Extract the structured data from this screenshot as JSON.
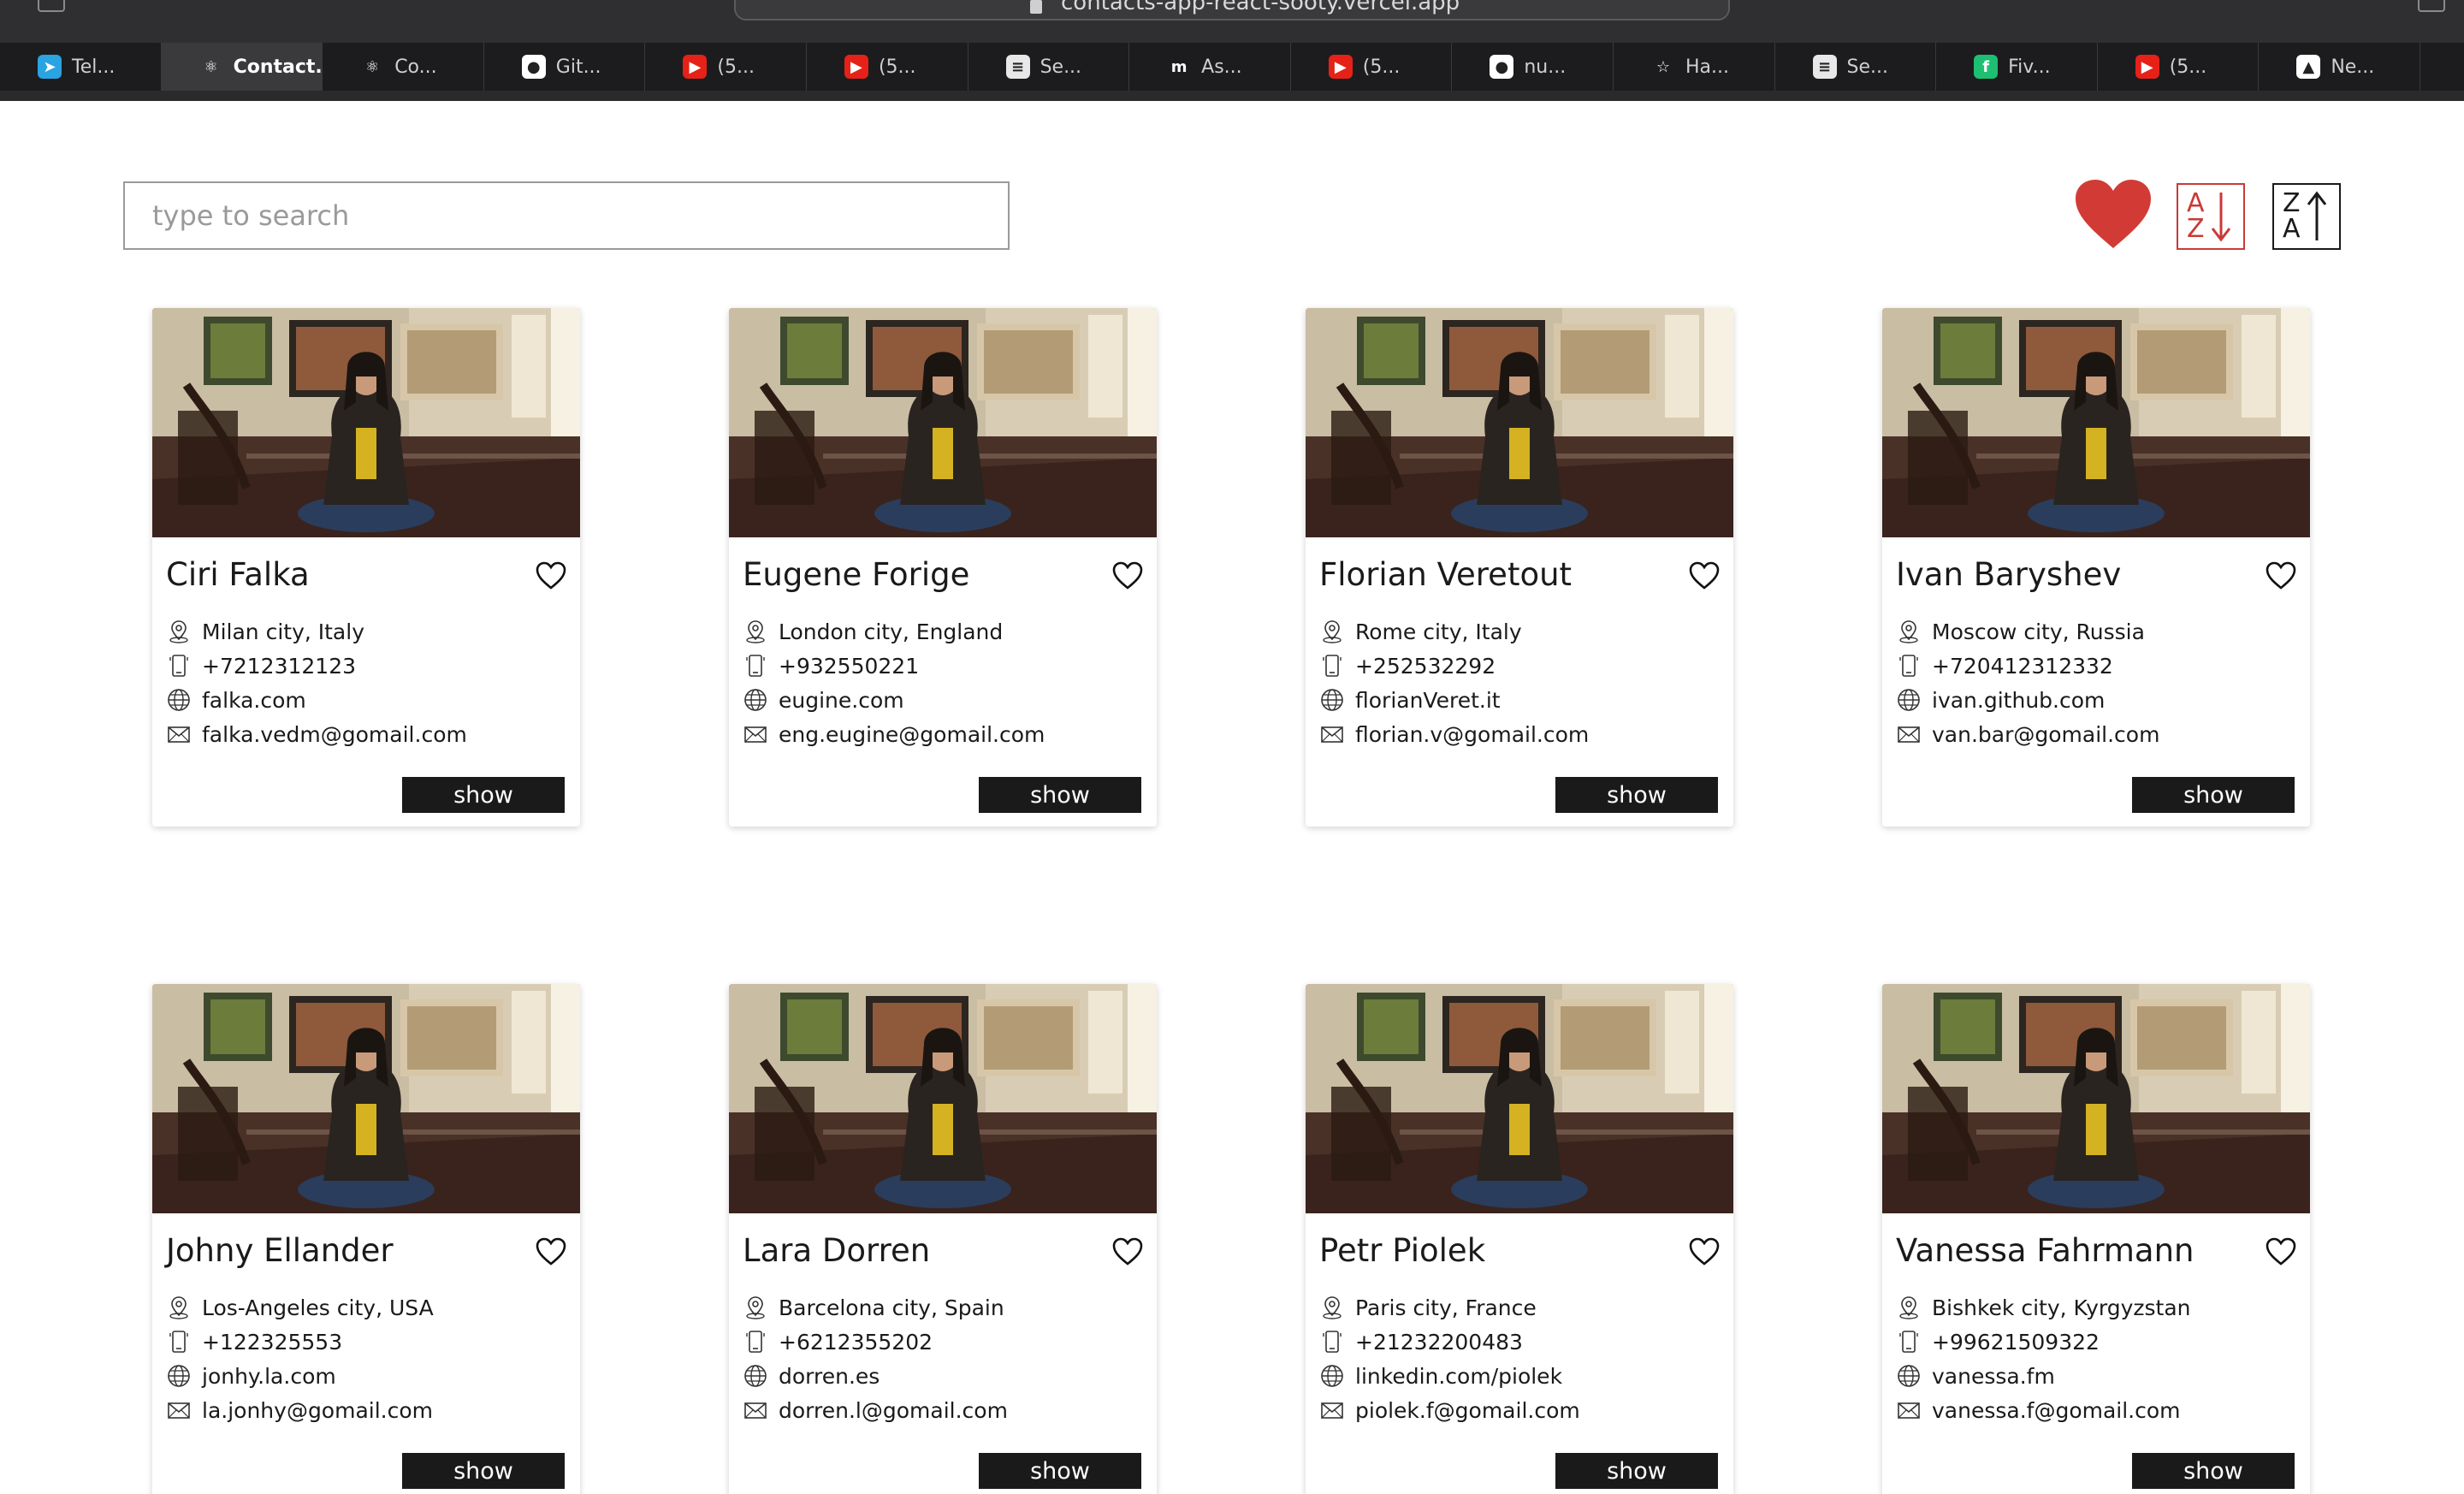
{
  "browser": {
    "url": "contacts-app-react-sooty.vercel.app",
    "tabs": [
      {
        "label": "Tel...",
        "icon": "telegram-icon",
        "color": "#2aa3e1",
        "glyph": "➤"
      },
      {
        "label": "Contact...",
        "icon": "react-icon",
        "color": "#3a3a3c",
        "glyph": "⚛",
        "active": true
      },
      {
        "label": "Co...",
        "icon": "react-icon",
        "color": "#1c1c1e",
        "glyph": "⚛"
      },
      {
        "label": "Git...",
        "icon": "github-icon",
        "color": "#ffffff",
        "glyph": "●"
      },
      {
        "label": "(5...",
        "icon": "youtube-icon",
        "color": "#e62117",
        "glyph": "▶"
      },
      {
        "label": "(5...",
        "icon": "youtube-icon",
        "color": "#e62117",
        "glyph": "▶"
      },
      {
        "label": "Se...",
        "icon": "document-icon",
        "color": "#e8e8e8",
        "glyph": "≡"
      },
      {
        "label": "As...",
        "icon": "m-icon",
        "color": "#1c1c1e",
        "glyph": "m"
      },
      {
        "label": "(5...",
        "icon": "youtube-icon",
        "color": "#e62117",
        "glyph": "▶"
      },
      {
        "label": "nu...",
        "icon": "github-icon",
        "color": "#ffffff",
        "glyph": "●"
      },
      {
        "label": "Ha...",
        "icon": "star-icon",
        "color": "#1c1c1e",
        "glyph": "☆"
      },
      {
        "label": "Se...",
        "icon": "document-icon",
        "color": "#e8e8e8",
        "glyph": "≡"
      },
      {
        "label": "Fiv...",
        "icon": "fiverr-icon",
        "color": "#1dbf73",
        "glyph": "f"
      },
      {
        "label": "(5...",
        "icon": "youtube-icon",
        "color": "#e62117",
        "glyph": "▶"
      },
      {
        "label": "Ne...",
        "icon": "triangle-icon",
        "color": "#ffffff",
        "glyph": "▲"
      }
    ]
  },
  "toolbar": {
    "search_placeholder": "type to search",
    "sort_az": {
      "top": "A",
      "bottom": "Z"
    },
    "sort_za": {
      "top": "Z",
      "bottom": "A"
    },
    "favorite_color": "#d23b35",
    "sort_az_color": "#c93a37"
  },
  "show_label": "show",
  "contacts": [
    {
      "name": "Ciri Falka",
      "city": "Milan city, Italy",
      "phone": "+7212312123",
      "site": "falka.com",
      "email": "falka.vedm@gomail.com"
    },
    {
      "name": "Eugene Forige",
      "city": "London city, England",
      "phone": "+932550221",
      "site": "eugine.com",
      "email": "eng.eugine@gomail.com"
    },
    {
      "name": "Florian Veretout",
      "city": "Rome city, Italy",
      "phone": "+252532292",
      "site": "florianVeret.it",
      "email": "florian.v@gomail.com"
    },
    {
      "name": "Ivan Baryshev",
      "city": "Moscow city, Russia",
      "phone": "+720412312332",
      "site": "ivan.github.com",
      "email": "van.bar@gomail.com"
    },
    {
      "name": "Johny Ellander",
      "city": "Los-Angeles city, USA",
      "phone": "+122325553",
      "site": "jonhy.la.com",
      "email": "la.jonhy@gomail.com"
    },
    {
      "name": "Lara Dorren",
      "city": "Barcelona city, Spain",
      "phone": "+6212355202",
      "site": "dorren.es",
      "email": "dorren.l@gomail.com"
    },
    {
      "name": "Petr Piolek",
      "city": "Paris city, France",
      "phone": "+21232200483",
      "site": "linkedin.com/piolek",
      "email": "piolek.f@gomail.com"
    },
    {
      "name": "Vanessa Fahrmann",
      "city": "Bishkek city, Kyrgyzstan",
      "phone": "+99621509322",
      "site": "vanessa.fm",
      "email": "vanessa.f@gomail.com"
    }
  ]
}
